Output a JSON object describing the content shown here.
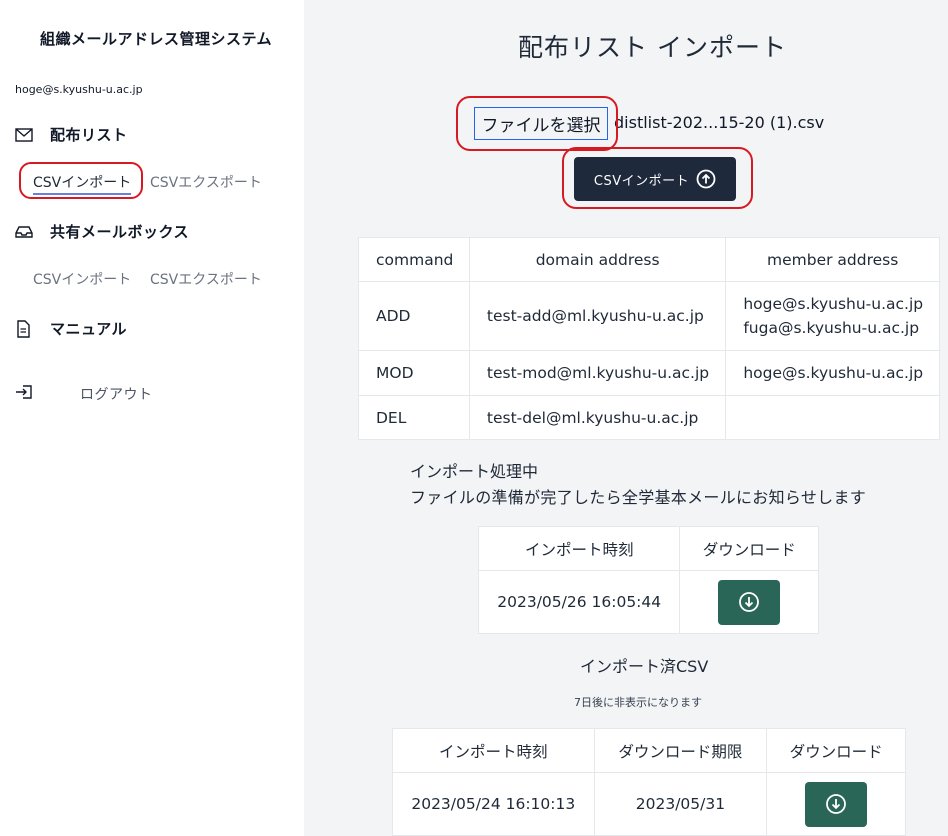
{
  "sidebar": {
    "app_title": "組織メールアドレス管理システム",
    "user_email": "hoge@s.kyushu-u.ac.jp",
    "sections": [
      {
        "label": "配布リスト",
        "icon": "mail-icon",
        "links": [
          "CSVインポート",
          "CSVエクスポート"
        ],
        "active_link": 0
      },
      {
        "label": "共有メールボックス",
        "icon": "inbox-icon",
        "links": [
          "CSVインポート",
          "CSVエクスポート"
        ]
      },
      {
        "label": "マニュアル",
        "icon": "document-icon"
      }
    ],
    "logout_label": "ログアウト"
  },
  "main": {
    "title": "配布リスト インポート",
    "file_button_label": "ファイルを選択",
    "file_name": "distlist-202...15-20 (1).csv",
    "import_button_label": "CSVインポート",
    "preview_table": {
      "headers": [
        "command",
        "domain address",
        "member address"
      ],
      "rows": [
        {
          "command": "ADD",
          "domain": "test-add@ml.kyushu-u.ac.jp",
          "members": [
            "hoge@s.kyushu-u.ac.jp",
            "fuga@s.kyushu-u.ac.jp"
          ]
        },
        {
          "command": "MOD",
          "domain": "test-mod@ml.kyushu-u.ac.jp",
          "members": [
            "hoge@s.kyushu-u.ac.jp"
          ]
        },
        {
          "command": "DEL",
          "domain": "test-del@ml.kyushu-u.ac.jp",
          "members": []
        }
      ]
    },
    "status_line1": "インポート処理中",
    "status_line2": "ファイルの準備が完了したら全学基本メールにお知らせします",
    "processing_table": {
      "headers": [
        "インポート時刻",
        "ダウンロード"
      ],
      "rows": [
        {
          "time": "2023/05/26 16:05:44"
        }
      ]
    },
    "imported_title": "インポート済CSV",
    "imported_note": "7日後に非表示になります",
    "imported_table": {
      "headers": [
        "インポート時刻",
        "ダウンロード期限",
        "ダウンロード"
      ],
      "rows": [
        {
          "time": "2023/05/24 16:10:13",
          "deadline": "2023/05/31"
        }
      ]
    }
  },
  "colors": {
    "primary_dark": "#1e293b",
    "download_green": "#2a6658",
    "highlight_red": "#d71a22",
    "main_bg": "#f3f4f6"
  }
}
